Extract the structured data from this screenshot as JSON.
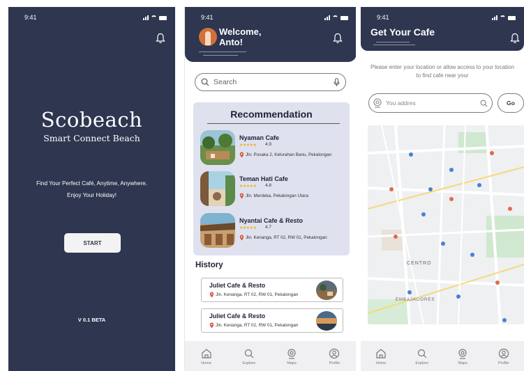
{
  "status": {
    "time": "9:41"
  },
  "screen1": {
    "title": "Scobeach",
    "subtitle": "Smart Connect Beach",
    "tagline_line1": "Find Your Perfect Café, Anytime, Anywhere.",
    "tagline_line2": "Enjoy Your Holiday!",
    "start_label": "START",
    "version": "V 0.1 BETA",
    "colors": {
      "background": "#2e3650",
      "button": "#f3f3f3"
    }
  },
  "screen2": {
    "welcome_line1": "Welcome,",
    "welcome_line2": "Anto!",
    "search_placeholder": "Search",
    "recommendation_title": "Recommendation",
    "recommendations": [
      {
        "name": "Nyaman Cafe",
        "rating": "4.9",
        "address": "Jln. Pusaka 2, Kelurahan Banu, Pekalongan"
      },
      {
        "name": "Teman Hati Cafe",
        "rating": "4.8",
        "address": "Jln. Merdeka, Pekalongan Utara"
      },
      {
        "name": "Nyantai Cafe & Resto",
        "rating": "4.7",
        "address": "Jln. Kenanga, RT 02, RW 01, Pekalongan"
      }
    ],
    "history_title": "History",
    "history": [
      {
        "name": "Juliet Cafe & Resto",
        "address": "Jln. Kenanga, RT 02, RW 01, Pekalongan"
      },
      {
        "name": "Juliet Cafe & Resto",
        "address": "Jln. Kenanga, RT 02, RW 01, Pekalongan"
      }
    ],
    "colors": {
      "header": "#2e3650",
      "panel": "#dfe1ef",
      "star": "#e8b21f",
      "pin": "#d2583a"
    }
  },
  "screen3": {
    "title": "Get Your Cafe",
    "instruction": "Please enter your location or allow access to your location to find cafe near your",
    "address_placeholder": "You addres",
    "go_label": "Go",
    "map_label_centro": "CENTRO",
    "map_label_embajadores": "EMBAJADORES"
  },
  "nav": [
    {
      "label": "Home",
      "icon": "home-icon"
    },
    {
      "label": "Explore",
      "icon": "search-icon"
    },
    {
      "label": "Maps",
      "icon": "location-icon"
    },
    {
      "label": "Profile",
      "icon": "profile-icon"
    }
  ]
}
